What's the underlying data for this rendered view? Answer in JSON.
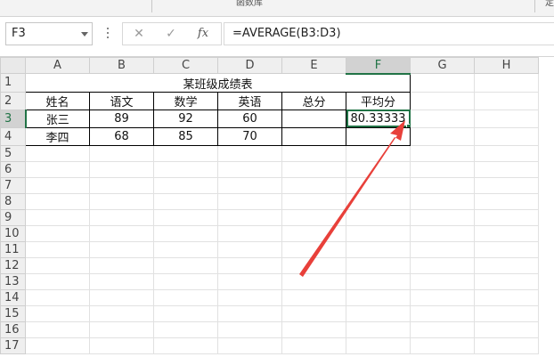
{
  "ribbon": {
    "group_label": "函数库",
    "edge_label": "定"
  },
  "formula_bar": {
    "name_box": "F3",
    "cancel_icon": "✕",
    "enter_icon": "✓",
    "fx_label": "fx",
    "formula": "=AVERAGE(B3:D3)"
  },
  "sheet": {
    "columns": [
      "A",
      "B",
      "C",
      "D",
      "E",
      "F",
      "G",
      "H"
    ],
    "rows": [
      "1",
      "2",
      "3",
      "4",
      "5",
      "6",
      "7",
      "8",
      "9",
      "10",
      "11",
      "12",
      "13",
      "14",
      "15",
      "16",
      "17"
    ],
    "selected_cell": "F3",
    "title": "某班级成绩表",
    "headers": [
      "姓名",
      "语文",
      "数学",
      "英语",
      "总分",
      "平均分"
    ],
    "students": [
      {
        "name": "张三",
        "chinese": "89",
        "math": "92",
        "english": "60",
        "total": "",
        "average": "80.33333"
      },
      {
        "name": "李四",
        "chinese": "68",
        "math": "85",
        "english": "70",
        "total": "",
        "average": ""
      }
    ]
  },
  "colors": {
    "accent": "#217346",
    "arrow": "#e8403a"
  },
  "icons": {
    "arrow": "red-annotation-arrow",
    "dropdown": "chevron-down-icon"
  }
}
